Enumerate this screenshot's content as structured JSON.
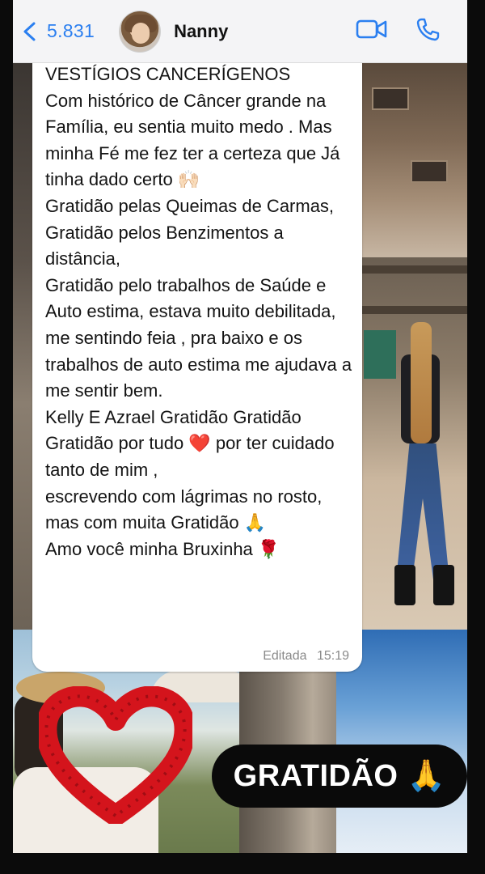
{
  "header": {
    "back_count": "5.831",
    "contact_name": "Nanny",
    "icons": [
      "chevron-left-icon",
      "video-call-icon",
      "phone-call-icon"
    ],
    "accent_color": "#2b7ff0"
  },
  "message": {
    "text": "VESTÍGIOS CANCERÍGENOS\nCom histórico de Câncer grande na Família, eu sentia muito medo . Mas minha Fé me fez ter a certeza que Já tinha dado certo 🙌🏻\nGratidão pelas Queimas de Carmas,   Gratidão pelos Benzimentos a distância,\nGratidão pelo trabalhos de Saúde e Auto estima, estava muito debilitada, me sentindo feia , pra baixo e os trabalhos de auto estima me ajudava a me sentir bem.\nKelly E Azrael Gratidão Gratidão\nGratidão por tudo ❤️ por ter cuidado tanto de mim ,\nescrevendo com lágrimas no rosto, mas com muita Gratidão 🙏\nAmo você minha Bruxinha 🌹",
    "edited_label": "Editada",
    "time": "15:19"
  },
  "overlay": {
    "sticker_text": "GRATIDÃO 🙏"
  }
}
